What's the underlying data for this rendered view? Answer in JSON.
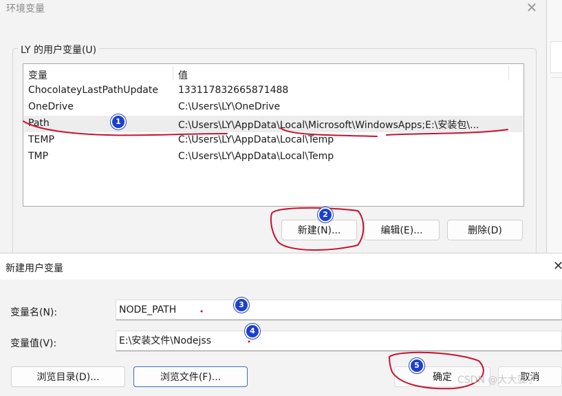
{
  "env_dialog": {
    "title": "环境变量",
    "user_group_label": "LY 的用户变量(U)",
    "columns": [
      "变量",
      "值"
    ],
    "rows": [
      {
        "name": "ChocolateyLastPathUpdate",
        "value": "133117832665871488"
      },
      {
        "name": "OneDrive",
        "value": "C:\\Users\\LY\\OneDrive"
      },
      {
        "name": "Path",
        "value": "C:\\Users\\LY\\AppData\\Local\\Microsoft\\WindowsApps;E:\\安装包\\..."
      },
      {
        "name": "TEMP",
        "value": "C:\\Users\\LY\\AppData\\Local\\Temp"
      },
      {
        "name": "TMP",
        "value": "C:\\Users\\LY\\AppData\\Local\\Temp"
      }
    ],
    "buttons": {
      "new": "新建(N)...",
      "edit": "编辑(E)...",
      "delete": "删除(D)"
    }
  },
  "new_dialog": {
    "title": "新建用户变量",
    "name_label": "变量名(N):",
    "name_value": "NODE_PATH",
    "value_label": "变量值(V):",
    "value_value": "E:\\安装文件\\Nodejss",
    "buttons": {
      "browse_dir": "浏览目录(D)...",
      "browse_file": "浏览文件(F)...",
      "ok": "确定",
      "cancel": "取消"
    }
  },
  "annotations": {
    "badges": [
      "1",
      "2",
      "3",
      "4",
      "5"
    ],
    "color": "#1d3fd0",
    "ink_color": "#c8102e"
  },
  "watermark": "CSDN @大大菠子",
  "icons": {
    "close": "close-icon"
  }
}
